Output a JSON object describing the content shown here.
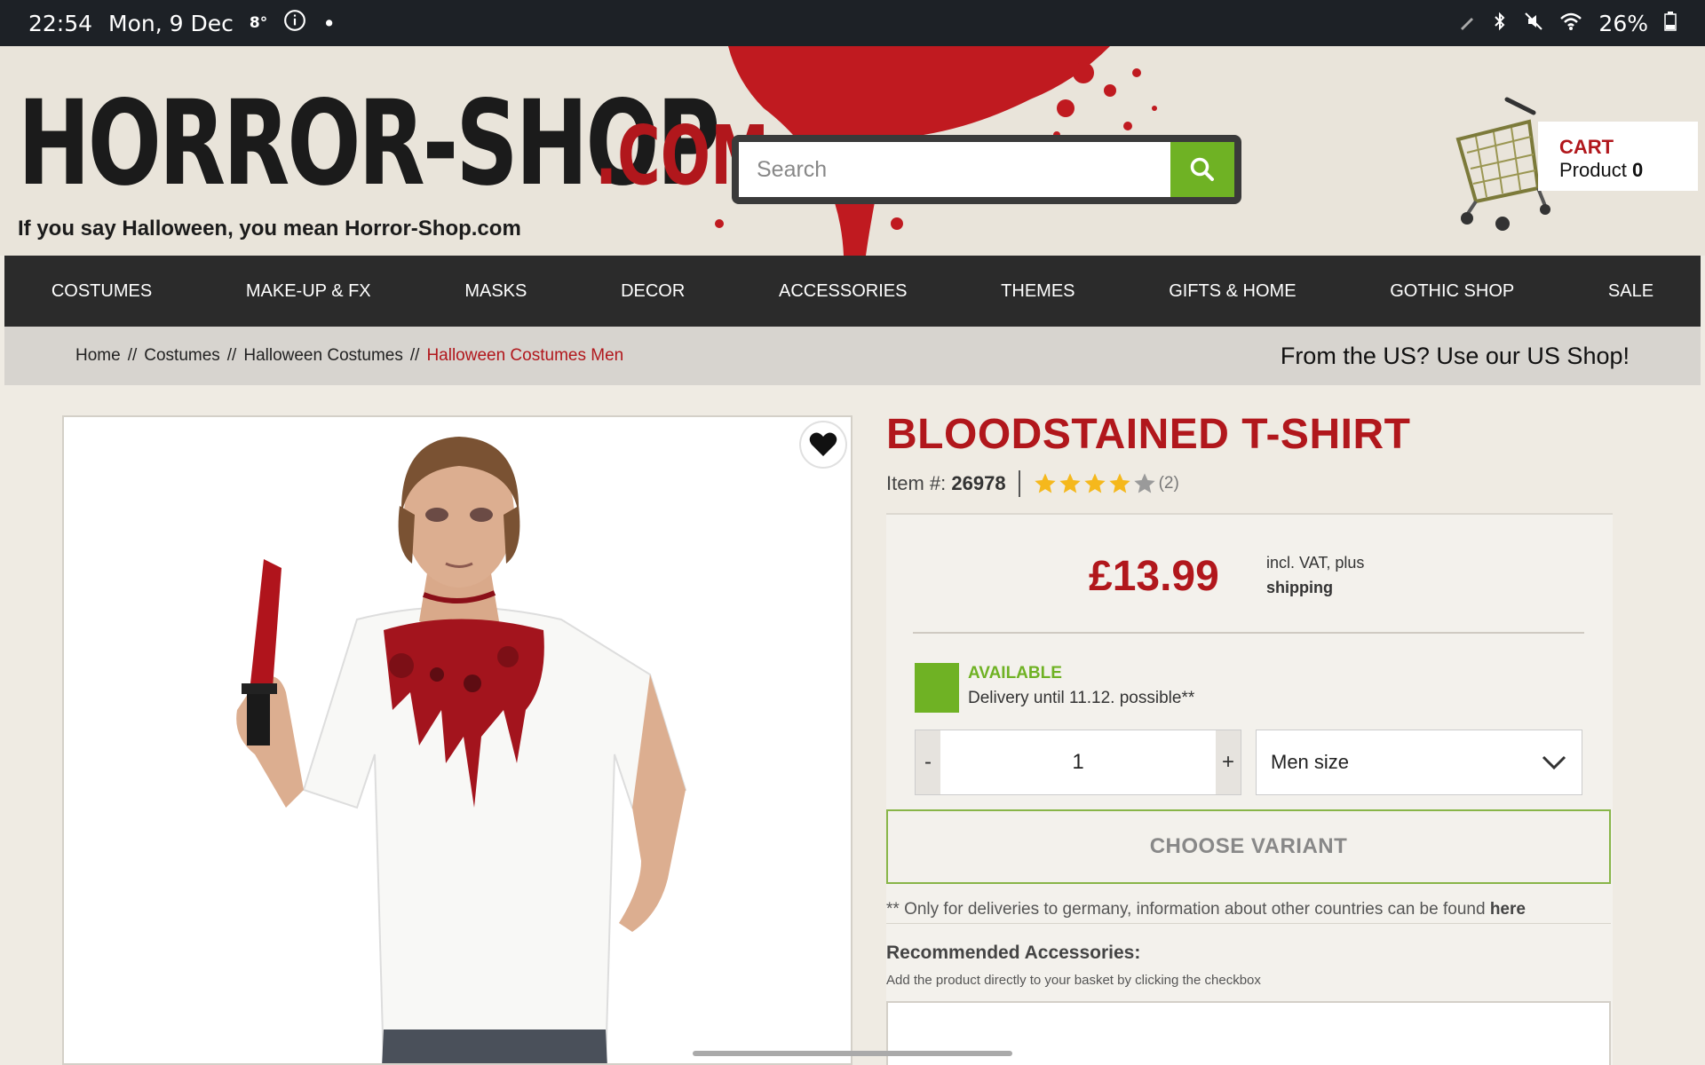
{
  "status_bar": {
    "time": "22:54",
    "date": "Mon, 9 Dec",
    "temperature": "8°",
    "battery": "26%",
    "icons": [
      "edit-icon",
      "bluetooth-icon",
      "mute-icon",
      "wifi-icon",
      "battery-icon"
    ]
  },
  "header": {
    "logo_main": "HORROR-SHOP",
    "logo_tld": ".COM",
    "tagline": "If you say Halloween, you mean Horror-Shop.com",
    "search_placeholder": "Search",
    "cart_label": "CART",
    "cart_text": "Product",
    "cart_count": "0"
  },
  "nav": {
    "items": [
      "COSTUMES",
      "MAKE-UP & FX",
      "MASKS",
      "DECOR",
      "ACCESSORIES",
      "THEMES",
      "GIFTS & HOME",
      "GOTHIC SHOP",
      "SALE"
    ]
  },
  "breadcrumb": {
    "items": [
      "Home",
      "Costumes",
      "Halloween Costumes",
      "Halloween Costumes Men"
    ],
    "separator": "//",
    "us_shop": "From the US? Use our US Shop!"
  },
  "product": {
    "title": "BLOODSTAINED T-SHIRT",
    "item_label": "Item #:",
    "item_number": "26978",
    "rating": 4,
    "rating_max": 5,
    "review_count": "(2)",
    "price": "£13.99",
    "vat_text": "incl. VAT, plus",
    "shipping_text": "shipping",
    "availability": "AVAILABLE",
    "delivery": "Delivery until 11.12. possible**",
    "quantity": "1",
    "minus": "-",
    "plus": "+",
    "size_select": "Men size",
    "choose_button": "CHOOSE VARIANT",
    "footnote": "** Only for deliveries to germany, information about other countries can be found",
    "footnote_link": "here",
    "recommended_title": "Recommended Accessories:",
    "recommended_sub": "Add the product directly to your basket by clicking the checkbox"
  },
  "colors": {
    "brand_red": "#b1171c",
    "accent_green": "#6fb224",
    "nav_bg": "#2b2b2b"
  }
}
